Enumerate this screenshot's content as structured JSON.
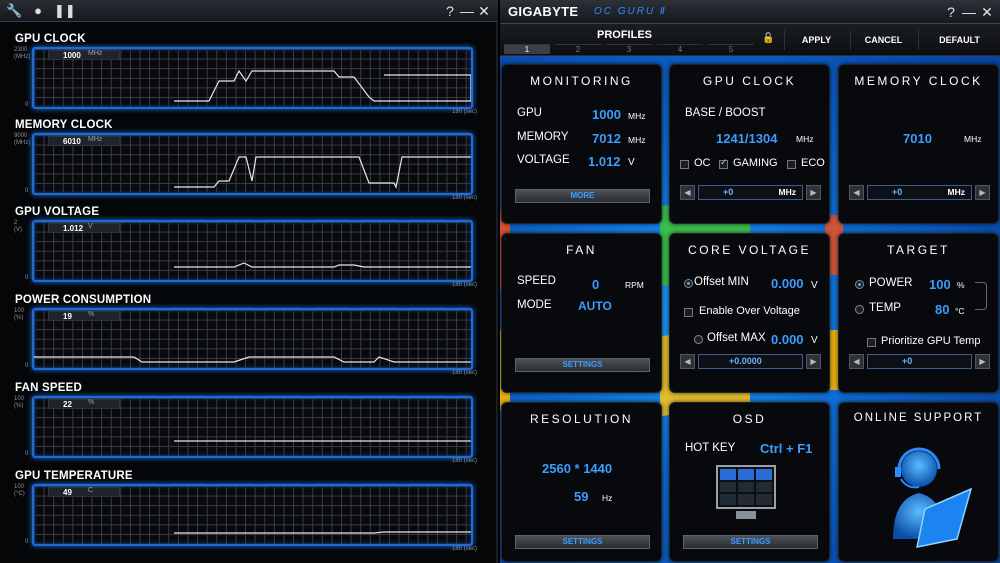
{
  "left": {
    "graphs": [
      {
        "label": "GPU CLOCK",
        "scale": "2300\n(MHz)",
        "value": "1000",
        "unit": "MHz",
        "secs": "180 (sec)",
        "zero": "0"
      },
      {
        "label": "MEMORY CLOCK",
        "scale": "9000\n(MHz)",
        "value": "6010",
        "unit": "MHz",
        "secs": "180 (sec)",
        "zero": "0"
      },
      {
        "label": "GPU VOLTAGE",
        "scale": "2\n(V)",
        "value": "1.012",
        "unit": "V",
        "secs": "180 (sec)",
        "zero": "0"
      },
      {
        "label": "POWER CONSUMPTION",
        "scale": "100\n(%)",
        "value": "19",
        "unit": "%",
        "secs": "180 (sec)",
        "zero": "0"
      },
      {
        "label": "FAN SPEED",
        "scale": "100\n(%)",
        "value": "22",
        "unit": "%",
        "secs": "180 (sec)",
        "zero": "0"
      },
      {
        "label": "GPU TEMPERATURE",
        "scale": "100\n(°C)",
        "value": "49",
        "unit": "C",
        "secs": "180 (sec)",
        "zero": "0"
      }
    ],
    "window_buttons": {
      "help": "?",
      "minimize": "—",
      "close": "✕"
    }
  },
  "right": {
    "brand": "GIGABYTE",
    "product": "OC GURU Ⅱ",
    "window_buttons": {
      "help": "?",
      "minimize": "—",
      "close": "✕"
    },
    "profiles_label": "PROFILES",
    "profile_tabs": [
      "1",
      "2",
      "3",
      "4",
      "5"
    ],
    "toolbar": {
      "apply": "APPLY",
      "cancel": "CANCEL",
      "default": "DEFAULT"
    },
    "monitoring": {
      "title": "MONITORING",
      "gpu_label": "GPU",
      "gpu_value": "1000",
      "gpu_unit": "MHz",
      "mem_label": "MEMORY",
      "mem_value": "7012",
      "mem_unit": "MHz",
      "volt_label": "VOLTAGE",
      "volt_value": "1.012",
      "volt_unit": "V",
      "button": "MORE"
    },
    "gpu_clock": {
      "title": "GPU CLOCK",
      "sub": "BASE / BOOST",
      "value": "1241/1304",
      "unit": "MHz",
      "oc": "OC",
      "gaming": "GAMING",
      "eco": "ECO",
      "step_value": "+0",
      "step_unit": "MHz"
    },
    "memory_clock": {
      "title": "MEMORY CLOCK",
      "value": "7010",
      "unit": "MHz",
      "step_value": "+0",
      "step_unit": "MHz"
    },
    "fan": {
      "title": "FAN",
      "speed_label": "SPEED",
      "speed_value": "0",
      "speed_unit": "RPM",
      "mode_label": "MODE",
      "mode_value": "AUTO",
      "button": "SETTINGS"
    },
    "core_voltage": {
      "title": "CORE VOLTAGE",
      "offset_min": "Offset MIN",
      "offset_min_value": "0.000",
      "offset_min_unit": "V",
      "enable_ov": "Enable Over Voltage",
      "offset_max": "Offset MAX",
      "offset_max_value": "0.000",
      "offset_max_unit": "V",
      "step_value": "+0.0000"
    },
    "target": {
      "title": "TARGET",
      "power": "POWER",
      "power_value": "100",
      "power_unit": "%",
      "temp": "TEMP",
      "temp_value": "80",
      "temp_unit": "°C",
      "prioritize": "Prioritize GPU Temp",
      "step_value": "+0"
    },
    "resolution": {
      "title": "RESOLUTION",
      "value": "2560 * 1440",
      "hz": "59",
      "hz_unit": "Hz",
      "button": "SETTINGS"
    },
    "osd": {
      "title": "OSD",
      "hotkey_label": "HOT KEY",
      "hotkey_value": "Ctrl + F1",
      "button": "SETTINGS"
    },
    "online_support": {
      "title": "ONLINE SUPPORT"
    },
    "colors": {
      "accent": "#3c9cff",
      "graph_border": "#1d6bd6"
    }
  }
}
